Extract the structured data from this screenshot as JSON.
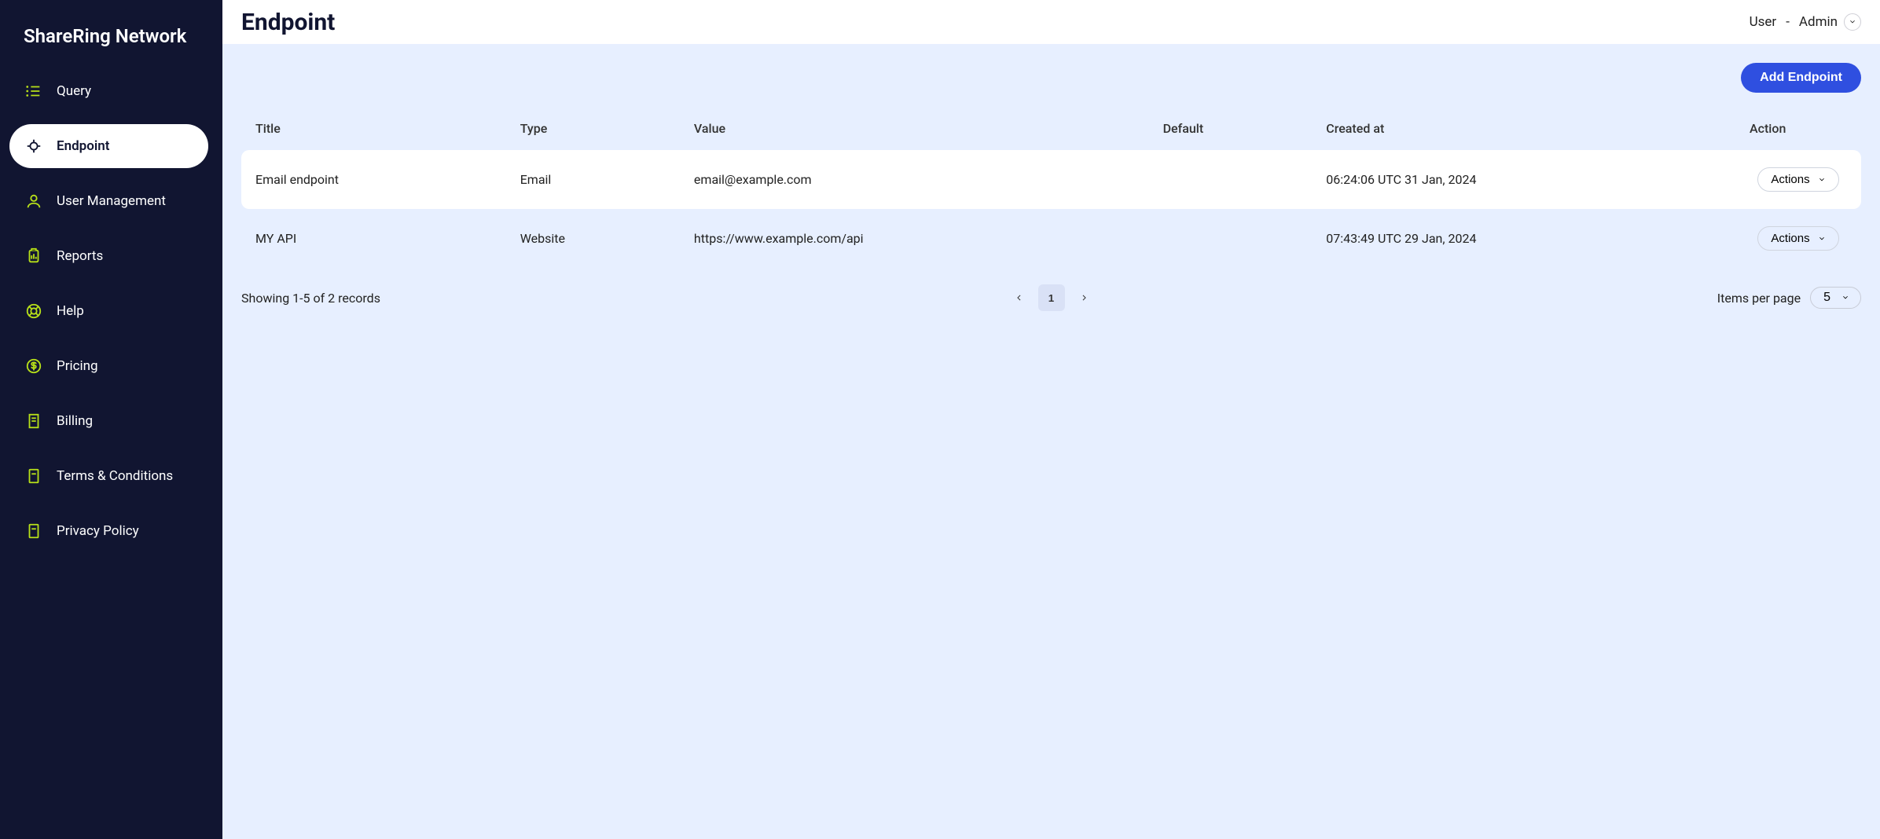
{
  "brand": "ShareRing Network",
  "page": {
    "title": "Endpoint"
  },
  "user": {
    "label_user": "User",
    "role": "Admin"
  },
  "sidebar": {
    "items": [
      {
        "label": "Query",
        "name": "query",
        "icon": "list-icon",
        "active": false
      },
      {
        "label": "Endpoint",
        "name": "endpoint",
        "icon": "target-icon",
        "active": true
      },
      {
        "label": "User Management",
        "name": "user-management",
        "icon": "user-icon",
        "active": false
      },
      {
        "label": "Reports",
        "name": "reports",
        "icon": "clipboard-icon",
        "active": false
      },
      {
        "label": "Help",
        "name": "help",
        "icon": "lifebuoy-icon",
        "active": false
      },
      {
        "label": "Pricing",
        "name": "pricing",
        "icon": "dollar-icon",
        "active": false
      },
      {
        "label": "Billing",
        "name": "billing",
        "icon": "receipt-icon",
        "active": false
      },
      {
        "label": "Terms & Conditions",
        "name": "terms",
        "icon": "document-icon",
        "active": false
      },
      {
        "label": "Privacy Policy",
        "name": "privacy",
        "icon": "document-icon",
        "active": false
      }
    ]
  },
  "toolbar": {
    "add_label": "Add Endpoint"
  },
  "table": {
    "columns": [
      "Title",
      "Type",
      "Value",
      "Default",
      "Created at",
      "Action"
    ],
    "action_label": "Actions",
    "rows": [
      {
        "title": "Email endpoint",
        "type": "Email",
        "value": "email@example.com",
        "default": "",
        "created_at": "06:24:06 UTC 31 Jan, 2024"
      },
      {
        "title": "MY API",
        "type": "Website",
        "value": "https://www.example.com/api",
        "default": "",
        "created_at": "07:43:49 UTC 29 Jan, 2024"
      }
    ]
  },
  "pagination": {
    "summary": "Showing 1-5 of 2 records",
    "current_page": "1",
    "items_per_page_label": "Items per page",
    "items_per_page_value": "5"
  }
}
